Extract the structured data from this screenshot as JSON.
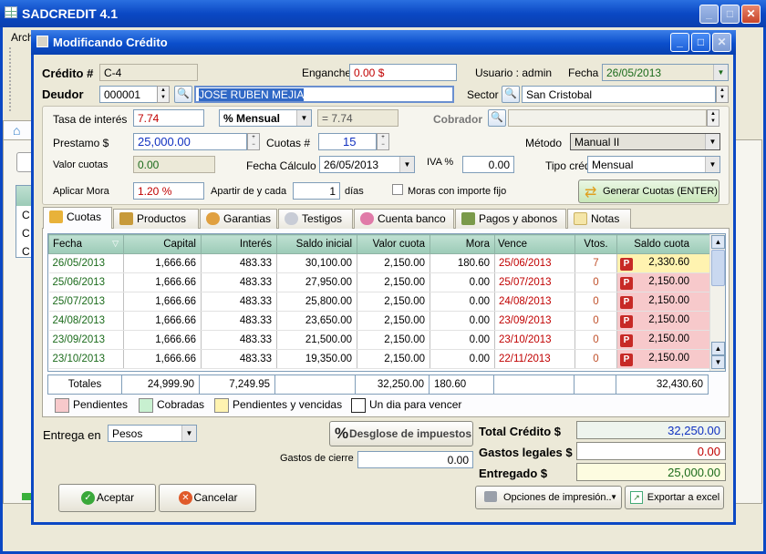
{
  "app": {
    "title": "SADCREDIT 4.1",
    "menu_partial": "Arch"
  },
  "dialog": {
    "title": "Modificando Crédito"
  },
  "form": {
    "credito_label": "Crédito #",
    "credito_value": "C-4",
    "enganche_label": "Enganche",
    "enganche_value": "0.00 $",
    "usuario_label": "Usuario : admin",
    "fecha_label": "Fecha",
    "fecha_value": "26/05/2013",
    "deudor_label": "Deudor",
    "deudor_id": "000001",
    "deudor_name": "JOSE RUBEN MEJIA",
    "sector_label": "Sector",
    "sector_value": "San Cristobal",
    "tasa_label": "Tasa de interés",
    "tasa_value": "7.74",
    "periodo_value": "% Mensual",
    "tasa_calc": "= 7.74",
    "cobrador_label": "Cobrador",
    "prestamo_label": "Prestamo $",
    "prestamo_value": "25,000.00",
    "cuotas_label": "Cuotas #",
    "cuotas_value": "15",
    "metodo_label": "Método",
    "metodo_value": "Manual II",
    "valor_cuotas_label": "Valor cuotas",
    "valor_cuotas_value": "0.00",
    "fecha_calculo_label": "Fecha Cálculo",
    "fecha_calculo_value": "26/05/2013",
    "iva_label": "IVA %",
    "iva_value": "0.00",
    "tipo_credito_label": "Tipo crédito",
    "tipo_credito_value": "Mensual",
    "mora_label": "Aplicar Mora",
    "mora_value": "1.20 %",
    "apartir_label": "Apartir de y cada",
    "apartir_value": "1",
    "dias_label": "días",
    "moras_importe_label": "Moras con importe  fijo",
    "generar_label": "Generar Cuotas (ENTER)"
  },
  "tabs": [
    {
      "label": "Cuotas",
      "color": "#e8b23a"
    },
    {
      "label": "Productos",
      "color": "#c79a3a"
    },
    {
      "label": "Garantias",
      "color": "#e0a040"
    },
    {
      "label": "Testigos",
      "color": "#9aa0b0"
    },
    {
      "label": "Cuenta banco",
      "color": "#e07aa8"
    },
    {
      "label": "Pagos y abonos",
      "color": "#7a9a4a"
    },
    {
      "label": "Notas",
      "color": "#e8d078"
    }
  ],
  "grid": {
    "headers": [
      "Fecha",
      "Capital",
      "Interés",
      "Saldo inicial",
      "Valor cuota",
      "Mora",
      "Vence",
      "Vtos.",
      "Saldo cuota"
    ],
    "rows": [
      [
        "26/05/2013",
        "1,666.66",
        "483.33",
        "30,100.00",
        "2,150.00",
        "180.60",
        "25/06/2013",
        "7",
        "2,330.60"
      ],
      [
        "25/06/2013",
        "1,666.66",
        "483.33",
        "27,950.00",
        "2,150.00",
        "0.00",
        "25/07/2013",
        "0",
        "2,150.00"
      ],
      [
        "25/07/2013",
        "1,666.66",
        "483.33",
        "25,800.00",
        "2,150.00",
        "0.00",
        "24/08/2013",
        "0",
        "2,150.00"
      ],
      [
        "24/08/2013",
        "1,666.66",
        "483.33",
        "23,650.00",
        "2,150.00",
        "0.00",
        "23/09/2013",
        "0",
        "2,150.00"
      ],
      [
        "23/09/2013",
        "1,666.66",
        "483.33",
        "21,500.00",
        "2,150.00",
        "0.00",
        "23/10/2013",
        "0",
        "2,150.00"
      ],
      [
        "23/10/2013",
        "1,666.66",
        "483.33",
        "19,350.00",
        "2,150.00",
        "0.00",
        "22/11/2013",
        "0",
        "2,150.00"
      ]
    ],
    "badge": "P",
    "totals": {
      "label": "Totales",
      "capital": "24,999.90",
      "interes": "7,249.95",
      "valor_cuota": "32,250.00",
      "mora": "180.60",
      "saldo_cuota": "32,430.60"
    }
  },
  "legend": [
    {
      "label": "Pendientes",
      "color": "#f7c9cb"
    },
    {
      "label": "Cobradas",
      "color": "#c8f0d0"
    },
    {
      "label": "Pendientes y vencidas",
      "color": "#fff3b0"
    },
    {
      "label": "Un dia para vencer",
      "color": "#ffffff"
    }
  ],
  "bottom": {
    "entrega_label": "Entrega en",
    "entrega_value": "Pesos",
    "desglose_label": "Desglose de impuestos",
    "gastos_cierre_label": "Gastos de cierre",
    "gastos_cierre_value": "0.00",
    "total_credito_label": "Total Crédito $",
    "total_credito_value": "32,250.00",
    "gastos_legales_label": "Gastos legales $",
    "gastos_legales_value": "0.00",
    "entregado_label": "Entregado $",
    "entregado_value": "25,000.00",
    "aceptar_label": "Aceptar",
    "cancelar_label": "Cancelar",
    "opciones_label": "Opciones de impresión..",
    "exportar_label": "Exportar a excel"
  },
  "colors": {
    "titlebar": "#0a48c4",
    "grid_header": "#9ccbb7",
    "badge": "#c72a26",
    "total_blue": "#1030c0",
    "legal_red": "#c00000",
    "entregado_green": "#1b6b1b"
  }
}
